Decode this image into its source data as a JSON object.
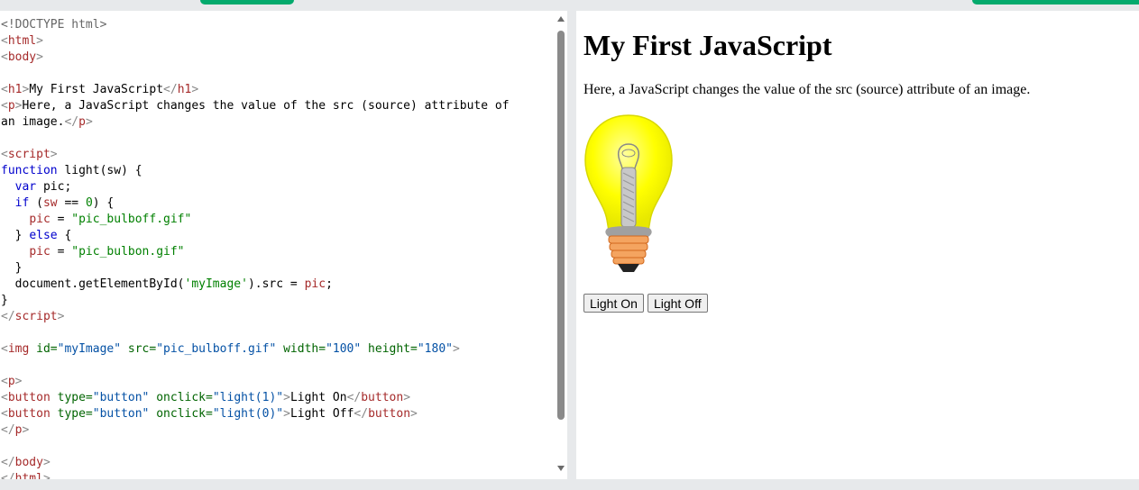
{
  "code_lines": [
    [
      {
        "t": "<!DOCTYPE html>",
        "c": "t-com"
      }
    ],
    [
      {
        "t": "<",
        "c": "t-br"
      },
      {
        "t": "html",
        "c": "t-tag"
      },
      {
        "t": ">",
        "c": "t-br"
      }
    ],
    [
      {
        "t": "<",
        "c": "t-br"
      },
      {
        "t": "body",
        "c": "t-tag"
      },
      {
        "t": ">",
        "c": "t-br"
      }
    ],
    [],
    [
      {
        "t": "<",
        "c": "t-br"
      },
      {
        "t": "h1",
        "c": "t-tag"
      },
      {
        "t": ">",
        "c": "t-br"
      },
      {
        "t": "My First JavaScript",
        "c": ""
      },
      {
        "t": "</",
        "c": "t-br"
      },
      {
        "t": "h1",
        "c": "t-tag"
      },
      {
        "t": ">",
        "c": "t-br"
      }
    ],
    [
      {
        "t": "<",
        "c": "t-br"
      },
      {
        "t": "p",
        "c": "t-tag"
      },
      {
        "t": ">",
        "c": "t-br"
      },
      {
        "t": "Here, a JavaScript changes the value of the src (source) attribute of",
        "c": ""
      }
    ],
    [
      {
        "t": "an image.",
        "c": ""
      },
      {
        "t": "</",
        "c": "t-br"
      },
      {
        "t": "p",
        "c": "t-tag"
      },
      {
        "t": ">",
        "c": "t-br"
      }
    ],
    [],
    [
      {
        "t": "<",
        "c": "t-br"
      },
      {
        "t": "script",
        "c": "t-tag"
      },
      {
        "t": ">",
        "c": "t-br"
      }
    ],
    [
      {
        "t": "function",
        "c": "t-kw"
      },
      {
        "t": " light(sw) {",
        "c": ""
      }
    ],
    [
      {
        "t": "  ",
        "c": ""
      },
      {
        "t": "var",
        "c": "t-kw"
      },
      {
        "t": " pic;",
        "c": ""
      }
    ],
    [
      {
        "t": "  ",
        "c": ""
      },
      {
        "t": "if",
        "c": "t-kw"
      },
      {
        "t": " (",
        "c": ""
      },
      {
        "t": "sw",
        "c": "t-var"
      },
      {
        "t": " == ",
        "c": ""
      },
      {
        "t": "0",
        "c": "t-str"
      },
      {
        "t": ") {",
        "c": ""
      }
    ],
    [
      {
        "t": "    ",
        "c": ""
      },
      {
        "t": "pic",
        "c": "t-var"
      },
      {
        "t": " = ",
        "c": ""
      },
      {
        "t": "\"pic_bulboff.gif\"",
        "c": "t-str"
      }
    ],
    [
      {
        "t": "  } ",
        "c": ""
      },
      {
        "t": "else",
        "c": "t-kw"
      },
      {
        "t": " {",
        "c": ""
      }
    ],
    [
      {
        "t": "    ",
        "c": ""
      },
      {
        "t": "pic",
        "c": "t-var"
      },
      {
        "t": " = ",
        "c": ""
      },
      {
        "t": "\"pic_bulbon.gif\"",
        "c": "t-str"
      }
    ],
    [
      {
        "t": "  }",
        "c": ""
      }
    ],
    [
      {
        "t": "  document.getElementById(",
        "c": ""
      },
      {
        "t": "'myImage'",
        "c": "t-str"
      },
      {
        "t": ").src = ",
        "c": ""
      },
      {
        "t": "pic",
        "c": "t-var"
      },
      {
        "t": ";",
        "c": ""
      }
    ],
    [
      {
        "t": "}",
        "c": ""
      }
    ],
    [
      {
        "t": "</",
        "c": "t-br"
      },
      {
        "t": "script",
        "c": "t-tag"
      },
      {
        "t": ">",
        "c": "t-br"
      }
    ],
    [],
    [
      {
        "t": "<",
        "c": "t-br"
      },
      {
        "t": "img",
        "c": "t-tag"
      },
      {
        "t": " id=",
        "c": "t-attr"
      },
      {
        "t": "\"myImage\"",
        "c": "t-val"
      },
      {
        "t": " src=",
        "c": "t-attr"
      },
      {
        "t": "\"pic_bulboff.gif\"",
        "c": "t-val"
      },
      {
        "t": " width=",
        "c": "t-attr"
      },
      {
        "t": "\"100\"",
        "c": "t-val"
      },
      {
        "t": " height=",
        "c": "t-attr"
      },
      {
        "t": "\"180\"",
        "c": "t-val"
      },
      {
        "t": ">",
        "c": "t-br"
      }
    ],
    [],
    [
      {
        "t": "<",
        "c": "t-br"
      },
      {
        "t": "p",
        "c": "t-tag"
      },
      {
        "t": ">",
        "c": "t-br"
      }
    ],
    [
      {
        "t": "<",
        "c": "t-br"
      },
      {
        "t": "button",
        "c": "t-tag"
      },
      {
        "t": " type=",
        "c": "t-attr"
      },
      {
        "t": "\"button\"",
        "c": "t-val"
      },
      {
        "t": " onclick=",
        "c": "t-attr"
      },
      {
        "t": "\"light(1)\"",
        "c": "t-val"
      },
      {
        "t": ">",
        "c": "t-br"
      },
      {
        "t": "Light On",
        "c": ""
      },
      {
        "t": "</",
        "c": "t-br"
      },
      {
        "t": "button",
        "c": "t-tag"
      },
      {
        "t": ">",
        "c": "t-br"
      }
    ],
    [
      {
        "t": "<",
        "c": "t-br"
      },
      {
        "t": "button",
        "c": "t-tag"
      },
      {
        "t": " type=",
        "c": "t-attr"
      },
      {
        "t": "\"button\"",
        "c": "t-val"
      },
      {
        "t": " onclick=",
        "c": "t-attr"
      },
      {
        "t": "\"light(0)\"",
        "c": "t-val"
      },
      {
        "t": ">",
        "c": "t-br"
      },
      {
        "t": "Light Off",
        "c": ""
      },
      {
        "t": "</",
        "c": "t-br"
      },
      {
        "t": "button",
        "c": "t-tag"
      },
      {
        "t": ">",
        "c": "t-br"
      }
    ],
    [
      {
        "t": "</",
        "c": "t-br"
      },
      {
        "t": "p",
        "c": "t-tag"
      },
      {
        "t": ">",
        "c": "t-br"
      }
    ],
    [],
    [
      {
        "t": "</",
        "c": "t-br"
      },
      {
        "t": "body",
        "c": "t-tag"
      },
      {
        "t": ">",
        "c": "t-br"
      }
    ],
    [
      {
        "t": "</",
        "c": "t-br"
      },
      {
        "t": "html",
        "c": "t-tag"
      },
      {
        "t": ">",
        "c": "t-br"
      }
    ]
  ],
  "result": {
    "heading": "My First JavaScript",
    "description": "Here, a JavaScript changes the value of the src (source) attribute of an image.",
    "light_on_label": "Light On",
    "light_off_label": "Light Off"
  },
  "colors": {
    "accent": "#04aa6d",
    "bulb_glass": "#ffff00",
    "bulb_base": "#f4a460"
  }
}
